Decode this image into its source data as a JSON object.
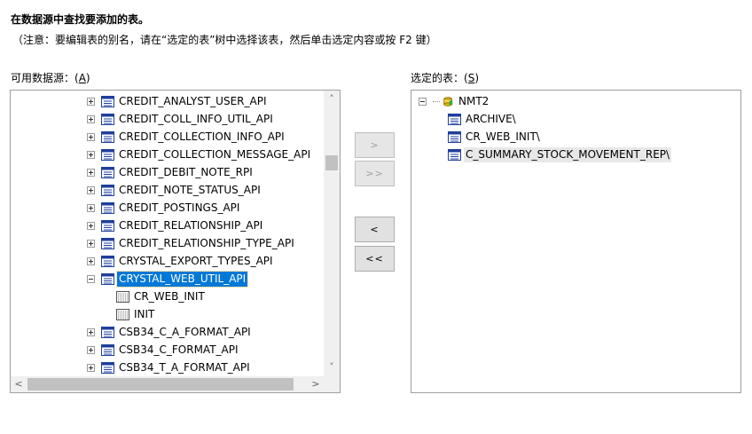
{
  "header": {
    "title": "在数据源中查找要添加的表。",
    "note": "（注意：要编辑表的别名，请在“选定的表”树中选择该表，然后单击选定内容或按 F2 键）"
  },
  "left": {
    "label_prefix": "可用数据源：(",
    "label_key": "A",
    "label_suffix": ")",
    "items": [
      {
        "label": "CREDIT_ANALYST_USER_API"
      },
      {
        "label": "CREDIT_COLL_INFO_UTIL_API"
      },
      {
        "label": "CREDIT_COLLECTION_INFO_API"
      },
      {
        "label": "CREDIT_COLLECTION_MESSAGE_API"
      },
      {
        "label": "CREDIT_DEBIT_NOTE_RPI"
      },
      {
        "label": "CREDIT_NOTE_STATUS_API"
      },
      {
        "label": "CREDIT_POSTINGS_API"
      },
      {
        "label": "CREDIT_RELATIONSHIP_API"
      },
      {
        "label": "CREDIT_RELATIONSHIP_TYPE_API"
      },
      {
        "label": "CRYSTAL_EXPORT_TYPES_API"
      },
      {
        "label": "CRYSTAL_WEB_UTIL_API"
      },
      {
        "label": "CR_WEB_INIT"
      },
      {
        "label": "INIT"
      },
      {
        "label": "CSB34_C_A_FORMAT_API"
      },
      {
        "label": "CSB34_C_FORMAT_API"
      },
      {
        "label": "CSB34_T_A_FORMAT_API"
      }
    ]
  },
  "right": {
    "label_prefix": "选定的表：(",
    "label_key": "S",
    "label_suffix": ")",
    "root": "NMT2",
    "items": [
      {
        "label": "ARCHIVE\\"
      },
      {
        "label": "CR_WEB_INIT\\"
      },
      {
        "label": "C_SUMMARY_STOCK_MOVEMENT_REP\\"
      }
    ]
  },
  "buttons": {
    "add": ">",
    "add_all": ">>",
    "remove": "<",
    "remove_all": "<<"
  },
  "colors": {
    "selection": "#0078d7",
    "icon": "#1f3f9c"
  }
}
